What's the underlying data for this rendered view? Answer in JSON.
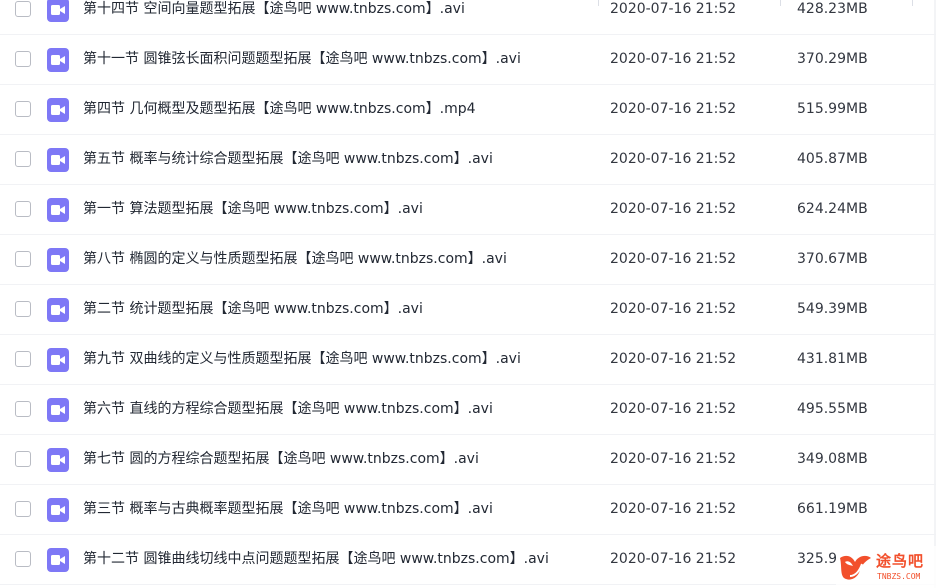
{
  "colors": {
    "file_icon_bg": "#7e78f6",
    "text": "#222833",
    "watermark": "#f2502c"
  },
  "file_icon": "video-file-icon",
  "files": [
    {
      "name": "第十四节 空间向量题型拓展【途鸟吧 www.tnbzs.com】.avi",
      "date": "2020-07-16 21:52",
      "size": "428.23MB"
    },
    {
      "name": "第十一节 圆锥弦长面积问题题型拓展【途鸟吧 www.tnbzs.com】.avi",
      "date": "2020-07-16 21:52",
      "size": "370.29MB"
    },
    {
      "name": "第四节 几何概型及题型拓展【途鸟吧 www.tnbzs.com】.mp4",
      "date": "2020-07-16 21:52",
      "size": "515.99MB"
    },
    {
      "name": "第五节 概率与统计综合题型拓展【途鸟吧 www.tnbzs.com】.avi",
      "date": "2020-07-16 21:52",
      "size": "405.87MB"
    },
    {
      "name": "第一节 算法题型拓展【途鸟吧 www.tnbzs.com】.avi",
      "date": "2020-07-16 21:52",
      "size": "624.24MB"
    },
    {
      "name": "第八节 椭圆的定义与性质题型拓展【途鸟吧 www.tnbzs.com】.avi",
      "date": "2020-07-16 21:52",
      "size": "370.67MB"
    },
    {
      "name": "第二节 统计题型拓展【途鸟吧 www.tnbzs.com】.avi",
      "date": "2020-07-16 21:52",
      "size": "549.39MB"
    },
    {
      "name": "第九节 双曲线的定义与性质题型拓展【途鸟吧 www.tnbzs.com】.avi",
      "date": "2020-07-16 21:52",
      "size": "431.81MB"
    },
    {
      "name": "第六节 直线的方程综合题型拓展【途鸟吧 www.tnbzs.com】.avi",
      "date": "2020-07-16 21:52",
      "size": "495.55MB"
    },
    {
      "name": "第七节 圆的方程综合题型拓展【途鸟吧 www.tnbzs.com】.avi",
      "date": "2020-07-16 21:52",
      "size": "349.08MB"
    },
    {
      "name": "第三节 概率与古典概率题型拓展【途鸟吧 www.tnbzs.com】.avi",
      "date": "2020-07-16 21:52",
      "size": "661.19MB"
    },
    {
      "name": "第十二节 圆锥曲线切线中点问题题型拓展【途鸟吧 www.tnbzs.com】.avi",
      "date": "2020-07-16 21:52",
      "size": "325.9"
    }
  ],
  "watermark": {
    "text": "途鸟吧",
    "sub": "TNBZS.COM"
  }
}
